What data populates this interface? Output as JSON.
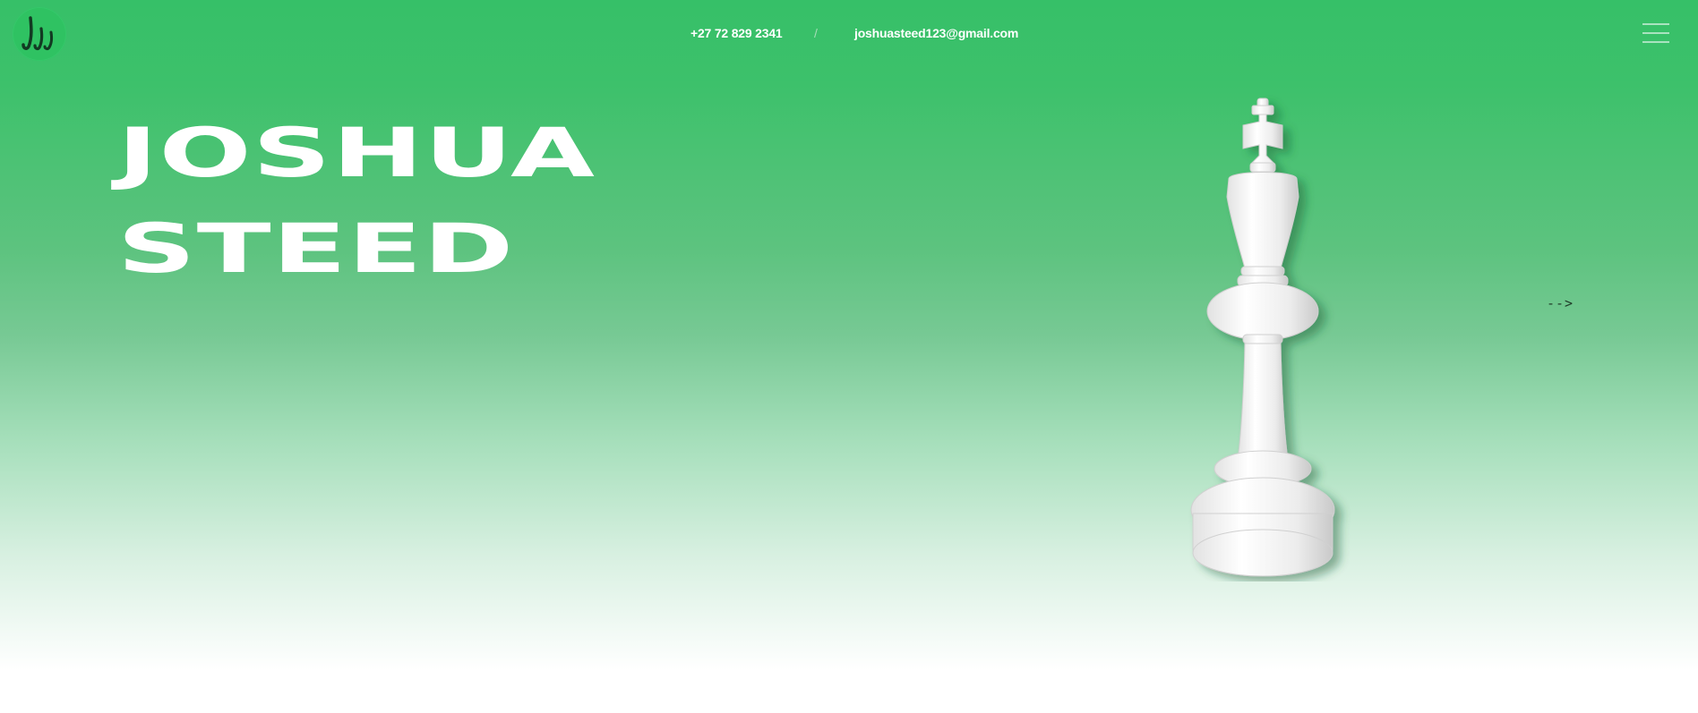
{
  "header": {
    "logo_icon": "signature-logo-icon",
    "phone": "+27 72 829 2341",
    "separator": "/",
    "email": "joshuasteed123@gmail.com",
    "menu_icon": "hamburger-menu-icon"
  },
  "hero": {
    "title_line1": "JOSHUA",
    "title_line2": "STEED",
    "arrow_text": "-->",
    "image_icon": "chess-king-icon"
  },
  "colors": {
    "accent_green": "#36c068",
    "text_light": "#ffffff"
  }
}
